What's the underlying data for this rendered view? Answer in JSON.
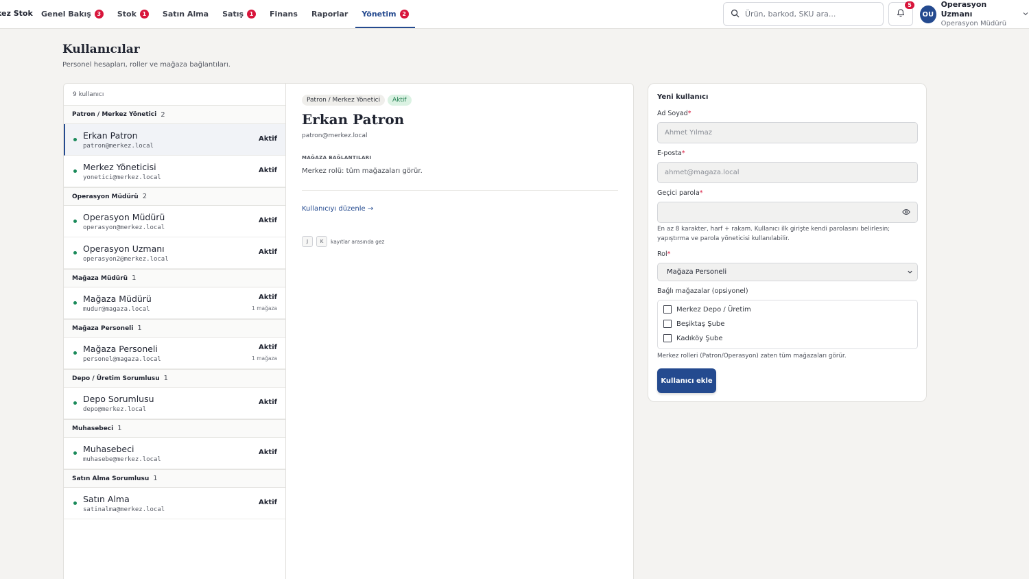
{
  "brand": "kez Stok",
  "nav": [
    {
      "label": "Genel Bakış",
      "badge": "3"
    },
    {
      "label": "Stok",
      "badge": "1"
    },
    {
      "label": "Satın Alma",
      "badge": ""
    },
    {
      "label": "Satış",
      "badge": "1"
    },
    {
      "label": "Finans",
      "badge": ""
    },
    {
      "label": "Raporlar",
      "badge": ""
    },
    {
      "label": "Yönetim",
      "badge": "2"
    }
  ],
  "search": {
    "placeholder": "Ürün, barkod, SKU ara..."
  },
  "notifications": {
    "count": "5"
  },
  "user": {
    "initials": "OU",
    "name": "Operasyon Uzmanı",
    "role": "Operasyon Müdürü"
  },
  "page": {
    "title": "Kullanıcılar",
    "subtitle": "Personel hesapları, roller ve mağaza bağlantıları."
  },
  "list": {
    "count_label": "9 kullanıcı",
    "groups": [
      {
        "name": "Patron / Merkez Yönetici",
        "count": "2",
        "users": [
          {
            "name": "Erkan Patron",
            "email": "patron@merkez.local",
            "status": "Aktif",
            "stores": ""
          },
          {
            "name": "Merkez Yöneticisi",
            "email": "yonetici@merkez.local",
            "status": "Aktif",
            "stores": ""
          }
        ]
      },
      {
        "name": "Operasyon Müdürü",
        "count": "2",
        "users": [
          {
            "name": "Operasyon Müdürü",
            "email": "operasyon@merkez.local",
            "status": "Aktif",
            "stores": ""
          },
          {
            "name": "Operasyon Uzmanı",
            "email": "operasyon2@merkez.local",
            "status": "Aktif",
            "stores": ""
          }
        ]
      },
      {
        "name": "Mağaza Müdürü",
        "count": "1",
        "users": [
          {
            "name": "Mağaza Müdürü",
            "email": "mudur@magaza.local",
            "status": "Aktif",
            "stores": "1 mağaza"
          }
        ]
      },
      {
        "name": "Mağaza Personeli",
        "count": "1",
        "users": [
          {
            "name": "Mağaza Personeli",
            "email": "personel@magaza.local",
            "status": "Aktif",
            "stores": "1 mağaza"
          }
        ]
      },
      {
        "name": "Depo / Üretim Sorumlusu",
        "count": "1",
        "users": [
          {
            "name": "Depo Sorumlusu",
            "email": "depo@merkez.local",
            "status": "Aktif",
            "stores": ""
          }
        ]
      },
      {
        "name": "Muhasebeci",
        "count": "1",
        "users": [
          {
            "name": "Muhasebeci",
            "email": "muhasebe@merkez.local",
            "status": "Aktif",
            "stores": ""
          }
        ]
      },
      {
        "name": "Satın Alma Sorumlusu",
        "count": "1",
        "users": [
          {
            "name": "Satın Alma",
            "email": "satinalma@merkez.local",
            "status": "Aktif",
            "stores": ""
          }
        ]
      }
    ]
  },
  "detail": {
    "role": "Patron / Merkez Yönetici",
    "status": "Aktif",
    "name": "Erkan Patron",
    "email": "patron@merkez.local",
    "stores_label": "MAĞAZA BAĞLANTILARI",
    "stores_text": "Merkez rolü: tüm mağazaları görür.",
    "edit_link": "Kullanıcıyı düzenle →",
    "kbd_j": "J",
    "kbd_k": "K",
    "kbd_hint": "kayıtlar arasında gez"
  },
  "form": {
    "title": "Yeni kullanıcı",
    "name_label": "Ad Soyad",
    "name_placeholder": "Ahmet Yılmaz",
    "email_label": "E-posta",
    "email_placeholder": "ahmet@magaza.local",
    "password_label": "Geçici parola",
    "password_hint": "En az 8 karakter, harf + rakam. Kullanıcı ilk girişte kendi parolasını belirlesin; yapıştırma ve parola yöneticisi kullanılabilir.",
    "role_label": "Rol",
    "role_value": "Mağaza Personeli",
    "stores_label": "Bağlı mağazalar (opsiyonel)",
    "stores": [
      "Merkez Depo / Üretim",
      "Beşiktaş Şube",
      "Kadıköy Şube"
    ],
    "stores_note": "Merkez rolleri (Patron/Operasyon) zaten tüm mağazaları görür.",
    "required_mark": "*",
    "submit": "Kullanıcı ekle"
  },
  "colors": {
    "accent": "#244a8f",
    "badge": "#d8153b",
    "active_dot": "#1a8a5a",
    "status_pill_bg": "#dbf2e3"
  }
}
